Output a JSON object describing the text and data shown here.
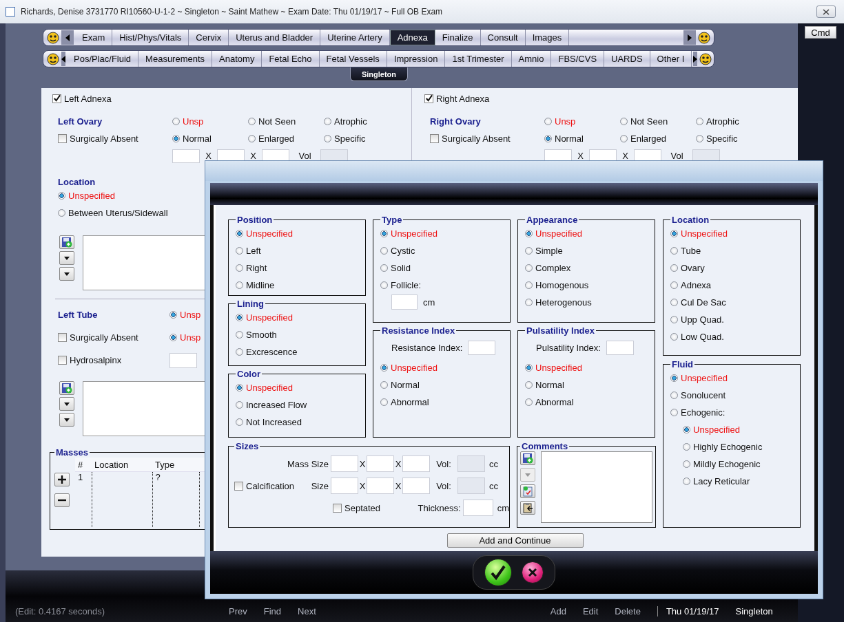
{
  "window": {
    "title": "Richards, Denise  3731770 RI10560-U-1-2 ~ Singleton ~ Saint Mathew ~ Exam Date: Thu 01/19/17 ~ Full OB Exam"
  },
  "cmd_button": "Cmd",
  "tabs": [
    {
      "label": "Exam",
      "selected": false
    },
    {
      "label": "Hist/Phys/Vitals",
      "selected": false
    },
    {
      "label": "Cervix",
      "selected": false
    },
    {
      "label": "Uterus and Bladder",
      "selected": false
    },
    {
      "label": "Uterine Artery",
      "selected": false
    },
    {
      "label": "Adnexa",
      "selected": true
    },
    {
      "label": "Finalize",
      "selected": false
    },
    {
      "label": "Consult",
      "selected": false
    },
    {
      "label": "Images",
      "selected": false
    }
  ],
  "subtabs": [
    {
      "label": "Pos/Plac/Fluid",
      "selected": false
    },
    {
      "label": "Measurements",
      "selected": false
    },
    {
      "label": "Anatomy",
      "selected": false
    },
    {
      "label": "Fetal Echo",
      "selected": false
    },
    {
      "label": "Fetal Vessels",
      "selected": false
    },
    {
      "label": "Impression",
      "selected": false
    },
    {
      "label": "1st Trimester",
      "selected": false
    },
    {
      "label": "Amnio",
      "selected": false
    },
    {
      "label": "FBS/CVS",
      "selected": false
    },
    {
      "label": "UARDS",
      "selected": false
    },
    {
      "label": "Other I",
      "selected": false
    }
  ],
  "page_tab": {
    "label": "Singleton",
    "selected": true
  },
  "left_adnexa": {
    "title": "Left Adnexa",
    "checked": true,
    "ovary": {
      "heading": "Left Ovary",
      "surgically_absent": {
        "label": "Surgically Absent",
        "checked": false
      },
      "options": [
        {
          "label": "Unsp",
          "selected": false,
          "default": true
        },
        {
          "label": "Not Seen",
          "selected": false,
          "default": false
        },
        {
          "label": "Atrophic",
          "selected": false,
          "default": false
        },
        {
          "label": "Normal",
          "selected": true,
          "default": false
        },
        {
          "label": "Enlarged",
          "selected": false,
          "default": false
        },
        {
          "label": "Specific",
          "selected": false,
          "default": false
        }
      ],
      "x_marks": [
        "X",
        "X"
      ],
      "vol_label": "Vol"
    },
    "location": {
      "heading": "Location",
      "options": [
        {
          "label": "Unspecified",
          "selected": true,
          "default": true
        },
        {
          "label": "Between Uterus/Sidewall",
          "selected": false,
          "default": false
        }
      ]
    },
    "tube": {
      "heading": "Left Tube",
      "surgically_absent": {
        "label": "Surgically Absent",
        "checked": false
      },
      "hydrosalpinx": {
        "label": "Hydrosalpinx",
        "checked": false
      },
      "options": [
        {
          "label": "Unsp",
          "selected": true,
          "default": true
        },
        {
          "label": "Unsp",
          "selected": true,
          "default": true
        }
      ]
    },
    "masses": {
      "title": "Masses",
      "columns": [
        "#",
        "Location",
        "Type"
      ],
      "rows": [
        {
          "number": "1",
          "type": "?"
        }
      ]
    }
  },
  "right_adnexa": {
    "title": "Right Adnexa",
    "checked": true,
    "ovary": {
      "heading": "Right Ovary",
      "surgically_absent": {
        "label": "Surgically Absent",
        "checked": false
      },
      "options": [
        {
          "label": "Unsp",
          "selected": false,
          "default": true
        },
        {
          "label": "Not Seen",
          "selected": false,
          "default": false
        },
        {
          "label": "Atrophic",
          "selected": false,
          "default": false
        },
        {
          "label": "Normal",
          "selected": true,
          "default": false
        },
        {
          "label": "Enlarged",
          "selected": false,
          "default": false
        },
        {
          "label": "Specific",
          "selected": false,
          "default": false
        }
      ],
      "x_marks": [
        "X",
        "X"
      ],
      "vol_label": "Vol"
    }
  },
  "dialog": {
    "position": {
      "title": "Position",
      "options": [
        {
          "label": "Unspecified",
          "selected": true,
          "default": true
        },
        {
          "label": "Left",
          "selected": false,
          "default": false
        },
        {
          "label": "Right",
          "selected": false,
          "default": false
        },
        {
          "label": "Midline",
          "selected": false,
          "default": false
        }
      ]
    },
    "lining": {
      "title": "Lining",
      "options": [
        {
          "label": "Unspecified",
          "selected": true,
          "default": true
        },
        {
          "label": "Smooth",
          "selected": false,
          "default": false
        },
        {
          "label": "Excrescence",
          "selected": false,
          "default": false
        }
      ]
    },
    "color": {
      "title": "Color",
      "options": [
        {
          "label": "Unspecified",
          "selected": true,
          "default": true
        },
        {
          "label": "Increased Flow",
          "selected": false,
          "default": false
        },
        {
          "label": "Not Increased",
          "selected": false,
          "default": false
        }
      ]
    },
    "type": {
      "title": "Type",
      "options": [
        {
          "label": "Unspecified",
          "selected": true,
          "default": true
        },
        {
          "label": "Cystic",
          "selected": false,
          "default": false
        },
        {
          "label": "Solid",
          "selected": false,
          "default": false
        },
        {
          "label": "Follicle:",
          "selected": false,
          "default": false,
          "unit": "cm"
        }
      ]
    },
    "resistance_index": {
      "title": "Resistance Index",
      "field_label": "Resistance Index:",
      "options": [
        {
          "label": "Unspecified",
          "selected": true,
          "default": true
        },
        {
          "label": "Normal",
          "selected": false,
          "default": false
        },
        {
          "label": "Abnormal",
          "selected": false,
          "default": false
        }
      ]
    },
    "appearance": {
      "title": "Appearance",
      "options": [
        {
          "label": "Unspecified",
          "selected": true,
          "default": true
        },
        {
          "label": "Simple",
          "selected": false,
          "default": false
        },
        {
          "label": "Complex",
          "selected": false,
          "default": false
        },
        {
          "label": "Homogenous",
          "selected": false,
          "default": false
        },
        {
          "label": "Heterogenous",
          "selected": false,
          "default": false
        }
      ]
    },
    "pulsatility_index": {
      "title": "Pulsatility Index",
      "field_label": "Pulsatility Index:",
      "options": [
        {
          "label": "Unspecified",
          "selected": true,
          "default": true
        },
        {
          "label": "Normal",
          "selected": false,
          "default": false
        },
        {
          "label": "Abnormal",
          "selected": false,
          "default": false
        }
      ]
    },
    "location": {
      "title": "Location",
      "options": [
        {
          "label": "Unspecified",
          "selected": true,
          "default": true
        },
        {
          "label": "Tube",
          "selected": false,
          "default": false
        },
        {
          "label": "Ovary",
          "selected": false,
          "default": false
        },
        {
          "label": "Adnexa",
          "selected": false,
          "default": false
        },
        {
          "label": "Cul De Sac",
          "selected": false,
          "default": false
        },
        {
          "label": "Upp Quad.",
          "selected": false,
          "default": false
        },
        {
          "label": "Low Quad.",
          "selected": false,
          "default": false
        }
      ]
    },
    "fluid": {
      "title": "Fluid",
      "options": [
        {
          "label": "Unspecified",
          "selected": true,
          "default": true
        },
        {
          "label": "Sonolucent",
          "selected": false,
          "default": false
        },
        {
          "label": "Echogenic:",
          "selected": false,
          "default": false,
          "children": [
            {
              "label": "Unspecified",
              "selected": true,
              "default": true
            },
            {
              "label": "Highly Echogenic",
              "selected": false,
              "default": false
            },
            {
              "label": "Mildly Echogenic",
              "selected": false,
              "default": false
            },
            {
              "label": "Lacy Reticular",
              "selected": false,
              "default": false
            }
          ]
        }
      ]
    },
    "sizes": {
      "title": "Sizes",
      "rows": [
        {
          "label": "Mass Size",
          "x_marks": [
            "X",
            "X"
          ],
          "vol_label": "Vol:",
          "unit": "cc"
        },
        {
          "label": "Size",
          "checkbox": {
            "label": "Calcification",
            "checked": false
          },
          "x_marks": [
            "X",
            "X"
          ],
          "vol_label": "Vol:",
          "unit": "cc"
        }
      ],
      "septated": {
        "label": "Septated",
        "checked": false
      },
      "thickness": {
        "label": "Thickness:",
        "unit": "cm"
      }
    },
    "comments": {
      "title": "Comments"
    },
    "add_button": "Add and Continue"
  },
  "status_bar": {
    "edit_time": "(Edit: 0.4167 seconds)",
    "nav": [
      "Prev",
      "Find",
      "Next"
    ],
    "actions": [
      "Add",
      "Edit",
      "Delete"
    ],
    "date": "Thu 01/19/17",
    "profile": "Singleton"
  }
}
